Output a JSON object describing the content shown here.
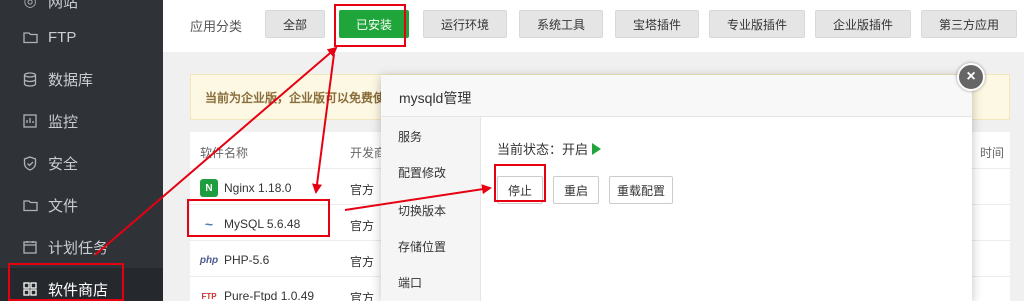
{
  "sidebar": {
    "items": [
      {
        "label": "网站",
        "icon": "globe-icon"
      },
      {
        "label": "FTP",
        "icon": "folder-icon"
      },
      {
        "label": "数据库",
        "icon": "database-icon"
      },
      {
        "label": "监控",
        "icon": "monitor-icon"
      },
      {
        "label": "安全",
        "icon": "shield-icon"
      },
      {
        "label": "文件",
        "icon": "folder-icon"
      },
      {
        "label": "计划任务",
        "icon": "clock-icon"
      },
      {
        "label": "软件商店",
        "icon": "grid-icon"
      }
    ]
  },
  "categories": {
    "label": "应用分类",
    "items": [
      "全部",
      "已安装",
      "运行环境",
      "系统工具",
      "宝塔插件",
      "专业版插件",
      "企业版插件",
      "第三方应用"
    ],
    "active_index": 1
  },
  "notice": "当前为企业版，企业版可以免费使",
  "table": {
    "headers": [
      "软件名称",
      "开发商"
    ],
    "right_header": "时间",
    "rows": [
      {
        "name": "Nginx 1.18.0",
        "dev": "官方",
        "logo": "N"
      },
      {
        "name": "MySQL 5.6.48",
        "dev": "官方",
        "logo": "~"
      },
      {
        "name": "PHP-5.6",
        "dev": "官方",
        "logo": "php"
      },
      {
        "name": "Pure-Ftpd 1.0.49",
        "dev": "官方",
        "logo": "FTP"
      }
    ]
  },
  "modal": {
    "title": "mysqld管理",
    "close": "×",
    "menu": [
      "服务",
      "配置修改",
      "切换版本",
      "存储位置",
      "端口"
    ],
    "status_label": "当前状态：",
    "status_value": "开启",
    "buttons": [
      "停止",
      "重启",
      "重载配置"
    ]
  },
  "colors": {
    "accent": "#20a53a",
    "sidebar": "#2f3338",
    "annotation": "#e60012"
  }
}
